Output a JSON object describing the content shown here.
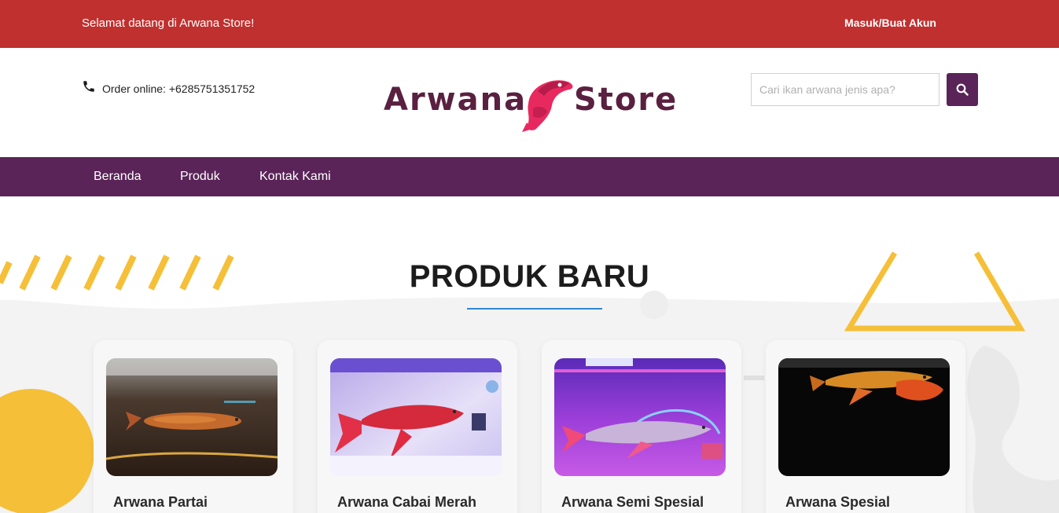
{
  "topbar": {
    "welcome": "Selamat datang di Arwana Store!",
    "login_link": "Masuk/Buat Akun"
  },
  "header": {
    "phone_text": "Order online: +6285751351752",
    "logo_left": "Arwana",
    "logo_right": "Store",
    "search_placeholder": "Cari ikan arwana jenis apa?"
  },
  "nav": {
    "items": [
      {
        "label": "Beranda"
      },
      {
        "label": "Produk"
      },
      {
        "label": "Kontak Kami"
      }
    ]
  },
  "section": {
    "title": "PRODUK BARU"
  },
  "products": [
    {
      "name": "Arwana Partai"
    },
    {
      "name": "Arwana Cabai Merah"
    },
    {
      "name": "Arwana Semi Spesial"
    },
    {
      "name": "Arwana Spesial"
    }
  ],
  "colors": {
    "topbar": "#c0302f",
    "brand_purple": "#5a2458",
    "accent_blue": "#2f86d2",
    "deco_yellow": "#f6bf38",
    "logo_pink": "#e8295f"
  },
  "icons": {
    "phone": "phone-icon",
    "search": "search-icon"
  }
}
